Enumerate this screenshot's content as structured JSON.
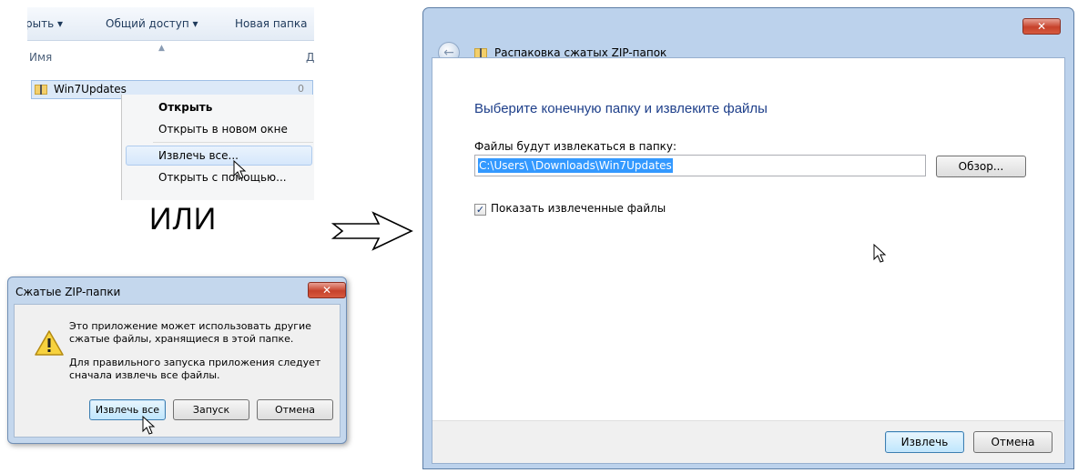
{
  "explorer": {
    "toolbar": [
      "рыть ▾",
      "Общий доступ ▾",
      "Новая папка"
    ],
    "column_name": "Имя",
    "column_date_fragment": "Д",
    "file_name": "Win7Updates",
    "file_date_fragment": "0",
    "context_menu": [
      "Открыть",
      "Открыть в новом окне",
      "Извлечь все...",
      "Открыть с помощью..."
    ]
  },
  "or_label": "ИЛИ",
  "small_dialog": {
    "title": "Сжатые ZIP-папки",
    "close": "✕",
    "message1": "Это приложение может использовать другие сжатые файлы, хранящиеся в этой папке.",
    "message2": "Для правильного запуска приложения следует сначала извлечь все файлы.",
    "buttons": [
      "Извлечь все",
      "Запуск",
      "Отмена"
    ]
  },
  "wizard": {
    "title": "Распаковка сжатых ZIP-папок",
    "close": "✕",
    "heading": "Выберите конечную папку и извлеките файлы",
    "path_label": "Файлы будут извлекаться в папку:",
    "path_value": "C:\\Users\\                    \\Downloads\\Win7Updates",
    "browse_button": "Обзор...",
    "show_files_label": "Показать извлеченные файлы",
    "show_files_checked": true,
    "extract_button": "Извлечь",
    "cancel_button": "Отмена"
  },
  "icons": {
    "zip": "zip-folder-icon",
    "warning": "warning-icon",
    "back": "back-arrow-icon",
    "cursor": "mouse-pointer-icon",
    "arrow": "right-arrow-outline-icon"
  },
  "colors": {
    "heading_blue": "#1e3f8a",
    "selection": "#3399ff",
    "close_red": "#c7422b",
    "frame_blue": "#bcd2ec"
  }
}
